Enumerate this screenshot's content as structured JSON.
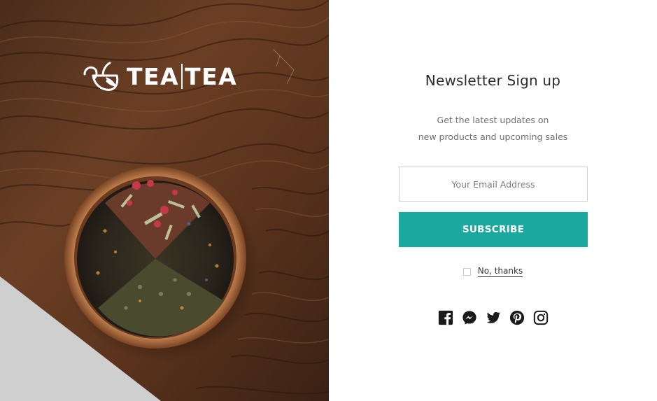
{
  "hero": {
    "logo_left": "TEA",
    "logo_right": "TEA",
    "logo_icon": "tea-leaf-cup-icon"
  },
  "form": {
    "title": "Newsletter Sign up",
    "subtitle_line1": "Get the latest updates on",
    "subtitle_line2": "new products and upcoming sales",
    "email_placeholder": "Your Email Address",
    "email_value": "",
    "subscribe_label": "SUBSCRIBE",
    "decline_label": "No, thanks",
    "decline_checked": false
  },
  "social": [
    {
      "name": "facebook-icon"
    },
    {
      "name": "messenger-icon"
    },
    {
      "name": "twitter-icon"
    },
    {
      "name": "pinterest-icon"
    },
    {
      "name": "instagram-icon"
    }
  ],
  "colors": {
    "accent": "#1ba89f",
    "title_text": "#2b2b2b",
    "muted_text": "#6f6f6f",
    "wood_dark": "#3d2416",
    "wood_mid": "#6b3f24"
  }
}
